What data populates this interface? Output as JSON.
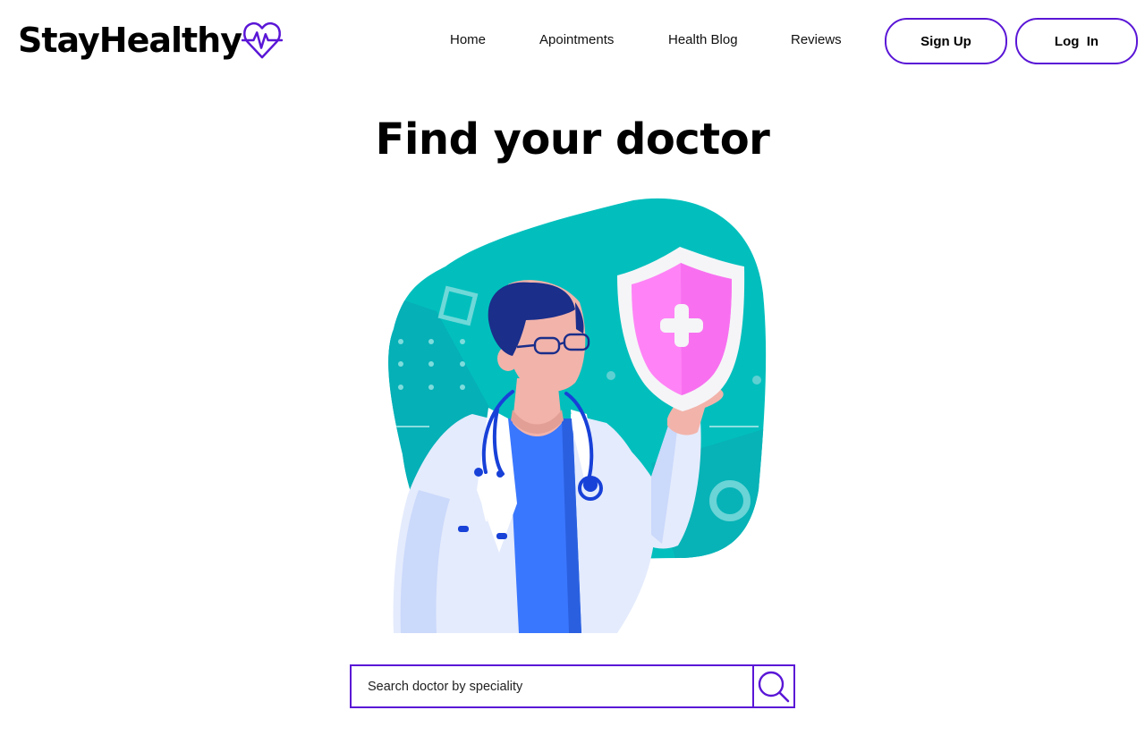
{
  "header": {
    "logo_text": "StayHealthy",
    "logo_icon": "heart-pulse-icon",
    "nav": {
      "home": "Home",
      "appointments": "Apointments",
      "health_blog": "Health Blog",
      "reviews": "Reviews"
    },
    "signup_label": "Sign Up",
    "login_label": "Log  In"
  },
  "main": {
    "title": "Find your doctor",
    "illustration": "doctor-with-shield-illustration"
  },
  "search": {
    "placeholder": "Search doctor by speciality",
    "value": "",
    "button_icon": "search-icon"
  },
  "colors": {
    "accent": "#5a16d6",
    "teal": "#02bfbd",
    "shield_pink": "#ff7ef5",
    "coat_blue": "#3a77ff"
  }
}
